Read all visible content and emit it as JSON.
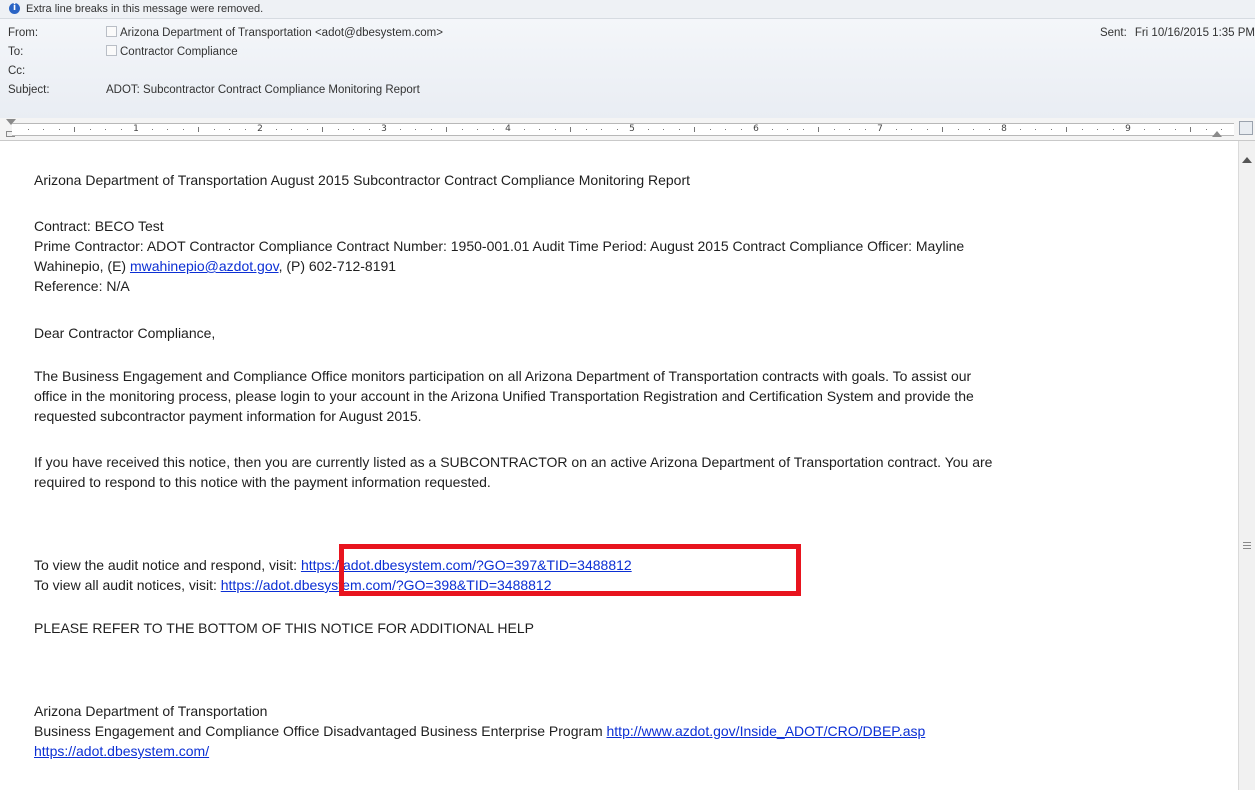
{
  "info_bar": {
    "text": "Extra line breaks in this message were removed."
  },
  "header": {
    "from_label": "From:",
    "from_value": "Arizona Department of Transportation <adot@dbesystem.com>",
    "to_label": "To:",
    "to_value": "Contractor Compliance",
    "cc_label": "Cc:",
    "cc_value": "",
    "subject_label": "Subject:",
    "subject_value": "ADOT: Subcontractor Contract Compliance Monitoring Report",
    "sent_label": "Sent:",
    "sent_value": "Fri 10/16/2015 1:35 PM"
  },
  "ruler": {
    "numbers": [
      "1",
      "2",
      "3",
      "4",
      "5",
      "6",
      "7",
      "8",
      "9"
    ]
  },
  "message": {
    "title_line": "Arizona Department of Transportation August 2015 Subcontractor Contract Compliance Monitoring Report",
    "contract_line": "Contract: BECO Test",
    "prime_line": "Prime Contractor: ADOT Contractor Compliance Contract Number: 1950-001.01 Audit Time Period: August 2015 Contract Compliance Officer: Mayline",
    "officer_prefix": "Wahinepio, (E) ",
    "officer_email": "mwahinepio@azdot.gov",
    "officer_phone": ", (P) 602-712-8191",
    "reference_line": "Reference: N/A",
    "greeting": "Dear Contractor Compliance,",
    "para1_line1": "The Business Engagement and Compliance Office monitors participation on all Arizona Department of Transportation contracts with goals.  To assist our",
    "para1_line2": "office in the monitoring process, please login to your account in the Arizona Unified Transportation Registration and Certification System and provide the",
    "para1_line3": "requested subcontractor payment information for August 2015.",
    "para2_line1": "If you have received this notice, then you are currently listed as a SUBCONTRACTOR on an active Arizona Department of Transportation contract. You are",
    "para2_line2": "required to respond to this notice with the payment information requested.",
    "audit_prefix": "To view the audit notice and respond, visit: ",
    "audit_link": "https://adot.dbesystem.com/?GO=397&TID=3488812",
    "all_prefix": "To view all audit notices, visit: ",
    "all_link": "https://adot.dbesystem.com/?GO=398&TID=3488812",
    "help_line": "PLEASE REFER TO THE BOTTOM OF THIS NOTICE FOR ADDITIONAL HELP",
    "sig_org": "Arizona Department of Transportation",
    "sig_office": "Business Engagement and Compliance Office Disadvantaged Business Enterprise Program ",
    "sig_link1": "http://www.azdot.gov/Inside_ADOT/CRO/DBEP.asp",
    "sig_link2": "https://adot.dbesystem.com/"
  },
  "colors": {
    "link": "#0b2fd4",
    "highlight": "#e8141e",
    "info_icon": "#2a64c5"
  }
}
